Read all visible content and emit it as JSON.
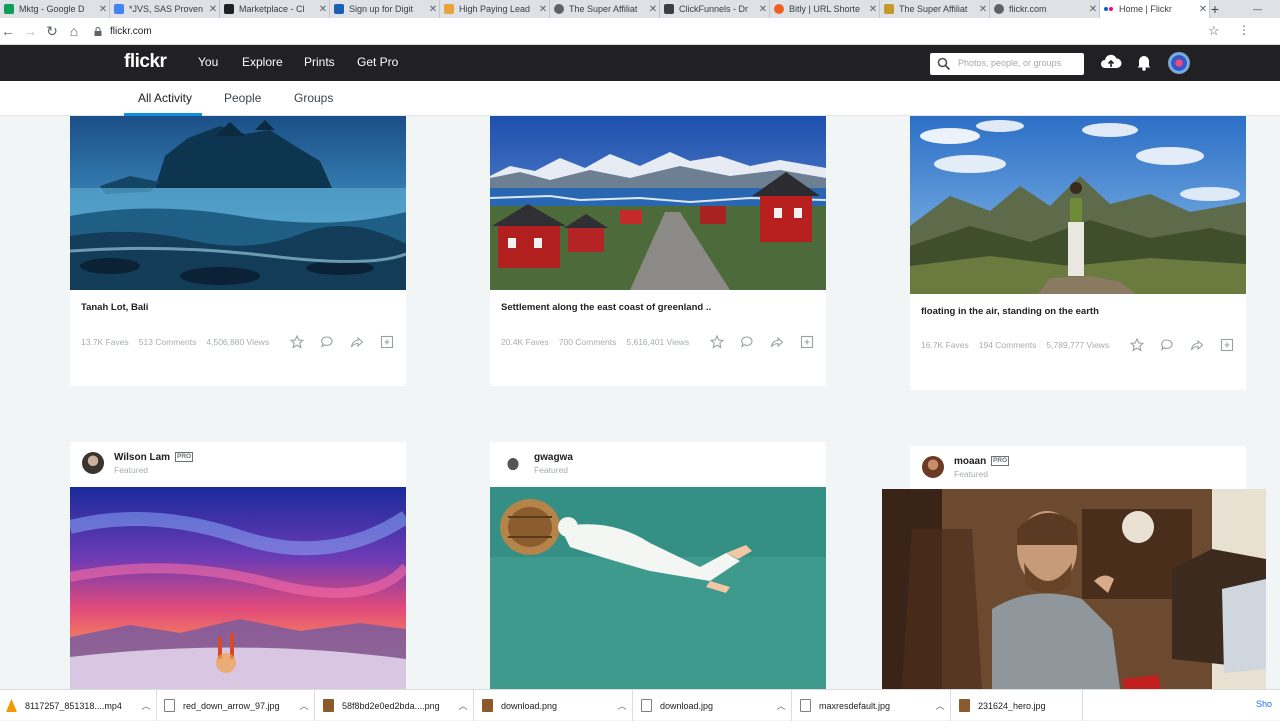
{
  "browser": {
    "tabs": [
      {
        "title": "Mktg - Google D",
        "color": "#0f9d58"
      },
      {
        "title": "*JVS, SAS Proven",
        "color": "#4285f4"
      },
      {
        "title": "Marketplace - Cl",
        "color": "#202124"
      },
      {
        "title": "Sign up for Digit",
        "color": "#1a5fb4"
      },
      {
        "title": "High Paying Lead",
        "color": "#e8a33b"
      },
      {
        "title": "The Super Affiliat",
        "color": "#5f6368"
      },
      {
        "title": "ClickFunnels - Dr",
        "color": "#3c4043"
      },
      {
        "title": "Bitly | URL Shorte",
        "color": "#ee6123"
      },
      {
        "title": "The Super Affiliat",
        "color": "#c49a2c"
      },
      {
        "title": "flickr.com",
        "color": "#5f6368"
      },
      {
        "title": "Home | Flickr",
        "color": "#ff0084",
        "active": true
      }
    ],
    "url": "flickr.com"
  },
  "flickr_nav": {
    "logo": "flickr",
    "links": [
      "You",
      "Explore",
      "Prints",
      "Get Pro"
    ],
    "search_placeholder": "Photos, people, or groups"
  },
  "subnav": {
    "tabs": [
      "All Activity",
      "People",
      "Groups"
    ],
    "active": "All Activity"
  },
  "feed": {
    "row1": [
      {
        "caption": "Tanah Lot, Bali",
        "faves": "13.7K Faves",
        "comments": "513 Comments",
        "views": "4,506,880 Views"
      },
      {
        "caption": "Settlement along the east coast of greenland ..",
        "faves": "20.4K Faves",
        "comments": "700 Comments",
        "views": "5,616,401 Views"
      },
      {
        "caption": "floating in the air, standing on the earth",
        "faves": "16.7K Faves",
        "comments": "194 Comments",
        "views": "5,789,777 Views"
      }
    ],
    "row2": [
      {
        "author": "Wilson Lam",
        "pro": "PRO",
        "featured": "Featured"
      },
      {
        "author": "gwagwa",
        "featured": "Featured"
      },
      {
        "author": "moaan",
        "pro": "PRO",
        "featured": "Featured"
      }
    ]
  },
  "downloads": [
    {
      "name": "8117257_851318....mp4",
      "color": "#f29900"
    },
    {
      "name": "red_down_arrow_97.jpg",
      "color": "#8a5a2a"
    },
    {
      "name": "58f8bd2e0ed2bda....png",
      "color": "#8a5a2a"
    },
    {
      "name": "download.png",
      "color": "#8a5a2a"
    },
    {
      "name": "download.jpg",
      "color": "#8a5a2a"
    },
    {
      "name": "maxresdefault.jpg",
      "color": "#8a5a2a"
    },
    {
      "name": "231624_hero.jpg",
      "color": "#8a5a2a"
    }
  ],
  "shelf_show_all": "Sho"
}
